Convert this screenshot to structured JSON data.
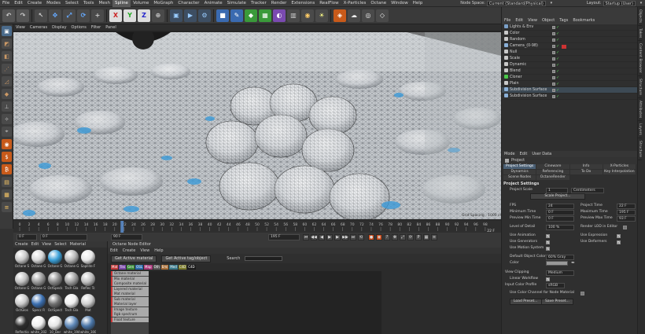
{
  "menubar": {
    "items": [
      "File",
      "Edit",
      "Create",
      "Modes",
      "Select",
      "Tools",
      "Mesh",
      "Spline",
      "Volume",
      "MoGraph",
      "Character",
      "Animate",
      "Simulate",
      "Tracker",
      "Render",
      "Extensions",
      "RealFlow",
      "X-Particles",
      "Octane",
      "Window",
      "Help"
    ],
    "active_index": 7,
    "node_space_label": "Node Space:",
    "node_space_value": "Current (Standard/Physical)",
    "layout_label": "Layout:",
    "layout_value": "Startup (User)"
  },
  "toolbar": {
    "axis_x": "X",
    "axis_y": "Y",
    "axis_z": "Z"
  },
  "viewport": {
    "menu": [
      "View",
      "Cameras",
      "Display",
      "Options",
      "Filter",
      "Panel"
    ]
  },
  "timeline": {
    "ticks": [
      "0",
      "2",
      "4",
      "6",
      "8",
      "10",
      "12",
      "14",
      "16",
      "18",
      "20",
      "22",
      "24",
      "26",
      "28",
      "30",
      "32",
      "34",
      "36",
      "38",
      "40",
      "42",
      "44",
      "46",
      "48",
      "50",
      "52",
      "54",
      "56",
      "58",
      "60",
      "62",
      "64",
      "66",
      "68",
      "70",
      "72",
      "74",
      "76",
      "78",
      "80",
      "82",
      "84",
      "86",
      "88",
      "90",
      "92",
      "94",
      "96",
      "98"
    ],
    "current_frame": "22 F",
    "playhead_fraction": 0.22
  },
  "transport": {
    "start_frame": "0 F",
    "start_frame2": "0 F",
    "end_frame": "90 F",
    "end_frame2": "195 F"
  },
  "material_manager": {
    "menu": [
      "Create",
      "Edit",
      "View",
      "Select",
      "Material"
    ],
    "materials": [
      {
        "name": "Octane S",
        "color": "#c8c8c8"
      },
      {
        "name": "Octane G",
        "color": "#d8d8d8"
      },
      {
        "name": "Octane G",
        "color": "#3aa0d8"
      },
      {
        "name": "Octane G",
        "color": "#b8b8b8"
      },
      {
        "name": "Sapllite F",
        "color": "#e8e8e8"
      },
      {
        "name": "Octane G",
        "color": "#c0c0c0"
      },
      {
        "name": "Octane G",
        "color": "#9a9a9a"
      },
      {
        "name": "OctSpeck",
        "color": "#8a8a8a"
      },
      {
        "name": "Tech Gla",
        "color": "#a0a0a0"
      },
      {
        "name": "Reflec Tc",
        "color": "#bfbfbf"
      },
      {
        "name": "OctGlos",
        "color": "#cacaca"
      },
      {
        "name": "Specc R",
        "color": "#3b6fb0"
      },
      {
        "name": "OctSpect",
        "color": "#707070"
      },
      {
        "name": "Tech Gla",
        "color": "#eeeeee"
      },
      {
        "name": "Mat",
        "color": "#d0d0d0"
      },
      {
        "name": "Reflectio",
        "color": "#2d2d2d"
      },
      {
        "name": "white_202",
        "color": "#f0f0f0"
      },
      {
        "name": "10_Der",
        "color": "#e6e6e6"
      },
      {
        "name": "white_194",
        "color": "#5f88b8"
      },
      {
        "name": "white_300",
        "color": "#4a76a8"
      }
    ]
  },
  "octane_editor": {
    "title": "Octane Node Editor",
    "menu": [
      "Edit",
      "Create",
      "View",
      "Help"
    ],
    "btn_material": "Get Active material",
    "btn_object": "Get Active tag/object",
    "search_label": "Search",
    "tags": [
      {
        "label": "Mat",
        "color": "#c23a3a"
      },
      {
        "label": "Tex",
        "color": "#7a4aa8"
      },
      {
        "label": "Gen",
        "color": "#3a8a3a"
      },
      {
        "label": "OSL",
        "color": "#2a6aa8"
      },
      {
        "label": "Map",
        "color": "#a83a7a"
      },
      {
        "label": "Oth",
        "color": "#5a5a5a"
      },
      {
        "label": "Emi",
        "color": "#a8703a"
      },
      {
        "label": "Med",
        "color": "#3a7a8a"
      },
      {
        "label": "C4D",
        "color": "#7a7a2a"
      },
      {
        "label": "C4D",
        "color": "#1a1a1a"
      }
    ],
    "list": [
      "Octane material",
      "Mix material",
      "Composite material",
      "Layered material",
      "Mat material",
      "Sub material",
      "Material layer",
      "Image texture",
      "Rgb spectrum",
      "Float texture"
    ]
  },
  "object_manager": {
    "menu": [
      "File",
      "Edit",
      "View",
      "Object",
      "Tags",
      "Bookmarks"
    ],
    "objects": [
      {
        "name": "Lights & Env",
        "color": "#7aa0c8"
      },
      {
        "name": "Color",
        "color": "#c8c8c8"
      },
      {
        "name": "Random",
        "color": "#c8c8c8"
      },
      {
        "name": "Camera_(0-98)",
        "color": "#8ab0d8"
      },
      {
        "name": "Null",
        "color": "#c8c8c8"
      },
      {
        "name": "Scale",
        "color": "#c8c8c8"
      },
      {
        "name": "Dynamic",
        "color": "#c8c8c8"
      },
      {
        "name": "Blend",
        "color": "#c8c8c8"
      },
      {
        "name": "Cloner",
        "color": "#4ac84a"
      },
      {
        "name": "Plain",
        "color": "#c8c8c8"
      },
      {
        "name": "Subdivision Surface",
        "color": "#8ab0d8"
      },
      {
        "name": "Subdivision Surface",
        "color": "#8ab0d8"
      }
    ]
  },
  "right_tabs": [
    "Objects",
    "Takes",
    "Content Browser",
    "Structure",
    "Attributes",
    "Layers",
    "Structure"
  ],
  "attributes": {
    "menu": [
      "Mode",
      "Edit",
      "User Data"
    ],
    "project_label": "Project",
    "tabs": [
      "Project Settings",
      "Cineware",
      "Info",
      "X-Particles",
      "Dynamics",
      "Referencing",
      "To Do",
      "Key Interpolation",
      "Scene Nodes",
      "OctaneRender"
    ],
    "section": "Project Settings",
    "project_scale_label": "Project Scale",
    "project_scale_value": "1",
    "project_scale_unit": "Centimeters",
    "scale_project_btn": "Scale Project...",
    "fps_label": "FPS",
    "fps_value": "24",
    "project_time_label": "Project Time",
    "project_time_value": "22 F",
    "min_time_label": "Minimum Time",
    "min_time_value": "0 F",
    "max_time_label": "Maximum Time",
    "max_time_value": "195 F",
    "preview_min_label": "Preview Min Time",
    "preview_min_value": "0 F",
    "preview_max_label": "Preview Max Time",
    "preview_max_value": "93 F",
    "lod_label": "Level of Detail",
    "lod_value": "100 %",
    "render_lod_label": "Render LOD in Editor",
    "use_animation": "Use Animation",
    "use_expression": "Use Expression",
    "use_generators": "Use Generators",
    "use_deformers": "Use Deformers",
    "use_motion": "Use Motion System",
    "default_color_label": "Default Object Color",
    "default_color_value": "60% Gray",
    "color_label": "Color",
    "view_clipping_label": "View Clipping",
    "view_clipping_value": "Medium",
    "linear_workflow": "Linear Workflow",
    "input_profile_label": "Input Color Profile",
    "input_profile_value": "sRGB",
    "use_color_channel": "Use Color Channel for Node Material",
    "load_preset": "Load Preset...",
    "save_preset": "Save Preset..."
  }
}
